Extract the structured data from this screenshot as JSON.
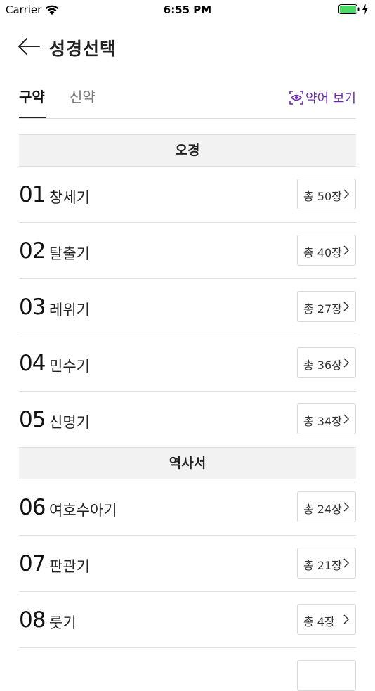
{
  "status_bar": {
    "carrier": "Carrier",
    "time": "6:55 PM",
    "battery_color": "#4cd964"
  },
  "header": {
    "title": "성경선택",
    "back_icon": "arrow-left-icon"
  },
  "tabs": {
    "old_testament": "구약",
    "new_testament": "신약",
    "active": "old_testament",
    "abbreviation_label": "약어 보기",
    "accent_color": "#6a2bb0"
  },
  "sections": [
    {
      "title": "오경",
      "books": [
        {
          "num": "01",
          "name": "창세기",
          "chapters": "총 50장"
        },
        {
          "num": "02",
          "name": "탈출기",
          "chapters": "총 40장"
        },
        {
          "num": "03",
          "name": "레위기",
          "chapters": "총 27장"
        },
        {
          "num": "04",
          "name": "민수기",
          "chapters": "총 36장"
        },
        {
          "num": "05",
          "name": "신명기",
          "chapters": "총 34장"
        }
      ]
    },
    {
      "title": "역사서",
      "books": [
        {
          "num": "06",
          "name": "여호수아기",
          "chapters": "총 24장"
        },
        {
          "num": "07",
          "name": "판관기",
          "chapters": "총 21장"
        },
        {
          "num": "08",
          "name": "룻기",
          "chapters": "총 4장"
        }
      ]
    }
  ]
}
